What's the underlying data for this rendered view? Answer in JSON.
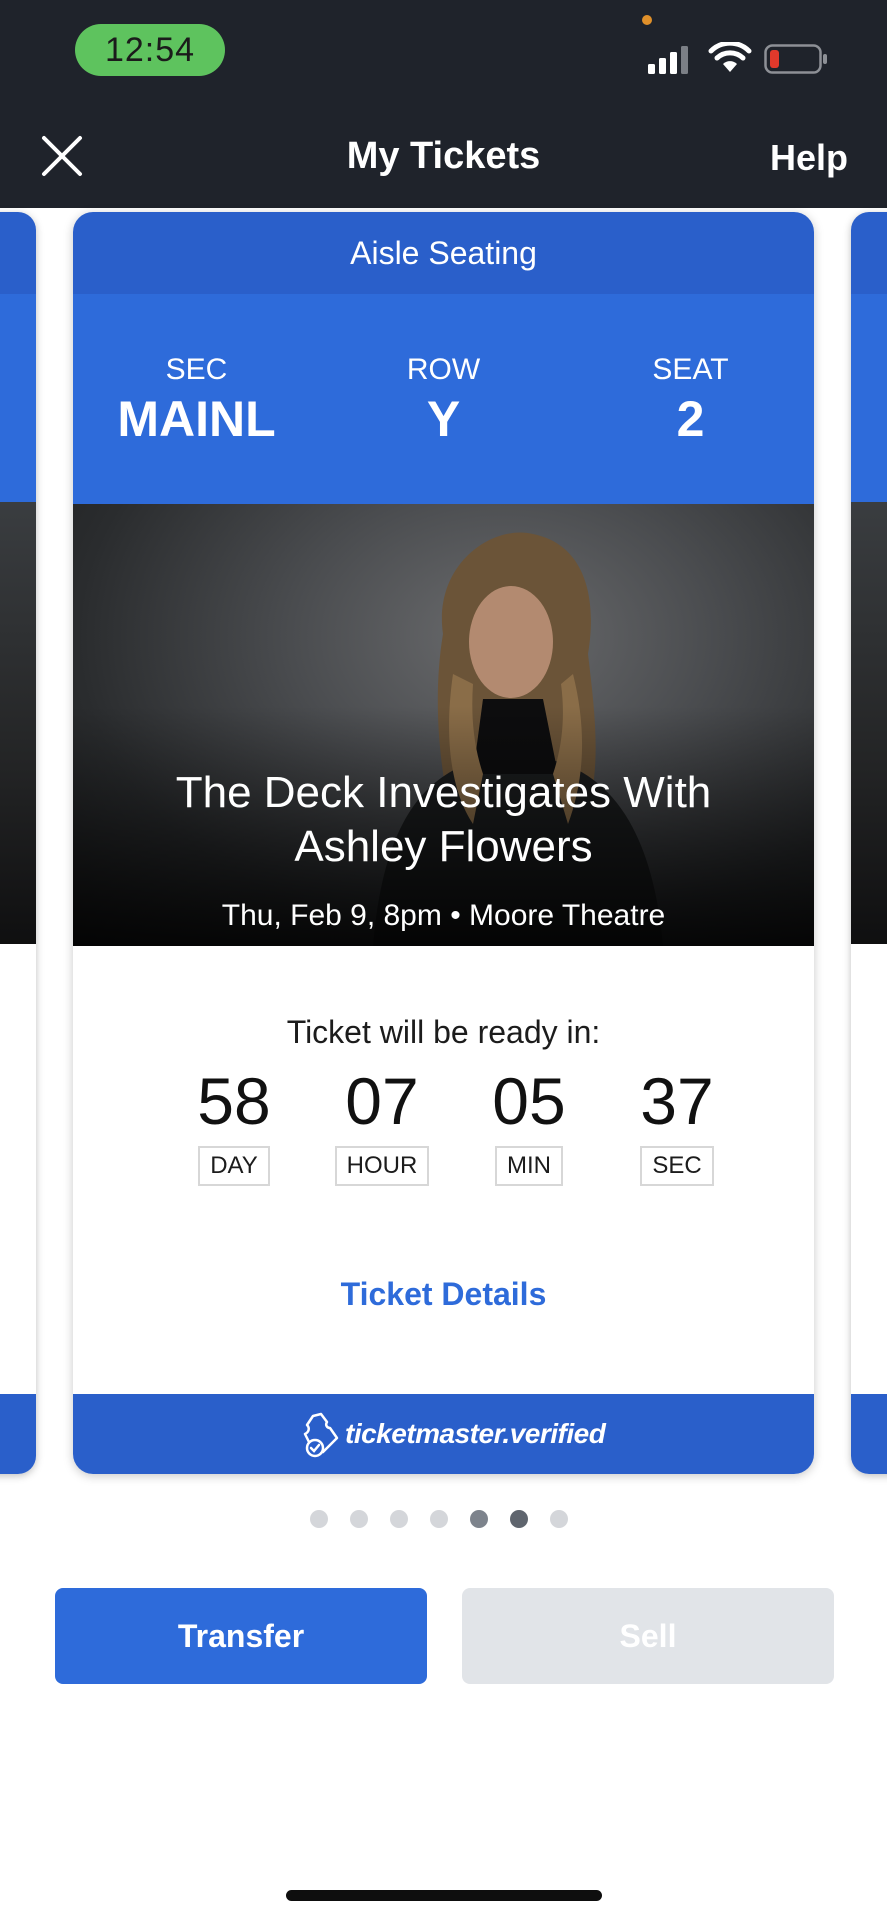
{
  "status_bar": {
    "time": "12:54",
    "colors": {
      "time_pill": "#5ec35e",
      "battery_low": "#e0392b",
      "camera_dot": "#e0902a"
    }
  },
  "nav": {
    "title": "My Tickets",
    "help_label": "Help",
    "close_icon": "close-x-icon"
  },
  "ticket": {
    "header": "Aisle Seating",
    "section_label": "SEC",
    "section_value": "MAINL",
    "row_label": "ROW",
    "row_value": "Y",
    "seat_label": "SEAT",
    "seat_value": "2",
    "event_title_line1": "The Deck Investigates With",
    "event_title_line2": "Ashley Flowers",
    "event_meta": "Thu, Feb 9, 8pm • Moore Theatre",
    "ready_label": "Ticket will be ready in:",
    "countdown": [
      {
        "value": "58",
        "unit": "DAY"
      },
      {
        "value": "07",
        "unit": "HOUR"
      },
      {
        "value": "05",
        "unit": "MIN"
      },
      {
        "value": "37",
        "unit": "SEC"
      }
    ],
    "details_link": "Ticket Details",
    "footer_brand": "ticketmaster.verified",
    "colors": {
      "header": "#2a5fca",
      "seat_band": "#2e6bda",
      "link": "#2e6bda"
    }
  },
  "pager": {
    "total": 7,
    "active_index": 5,
    "near_index": 4
  },
  "actions": {
    "transfer_label": "Transfer",
    "sell_label": "Sell",
    "colors": {
      "transfer_bg": "#2e6bda",
      "sell_bg": "#e1e4e8"
    }
  }
}
